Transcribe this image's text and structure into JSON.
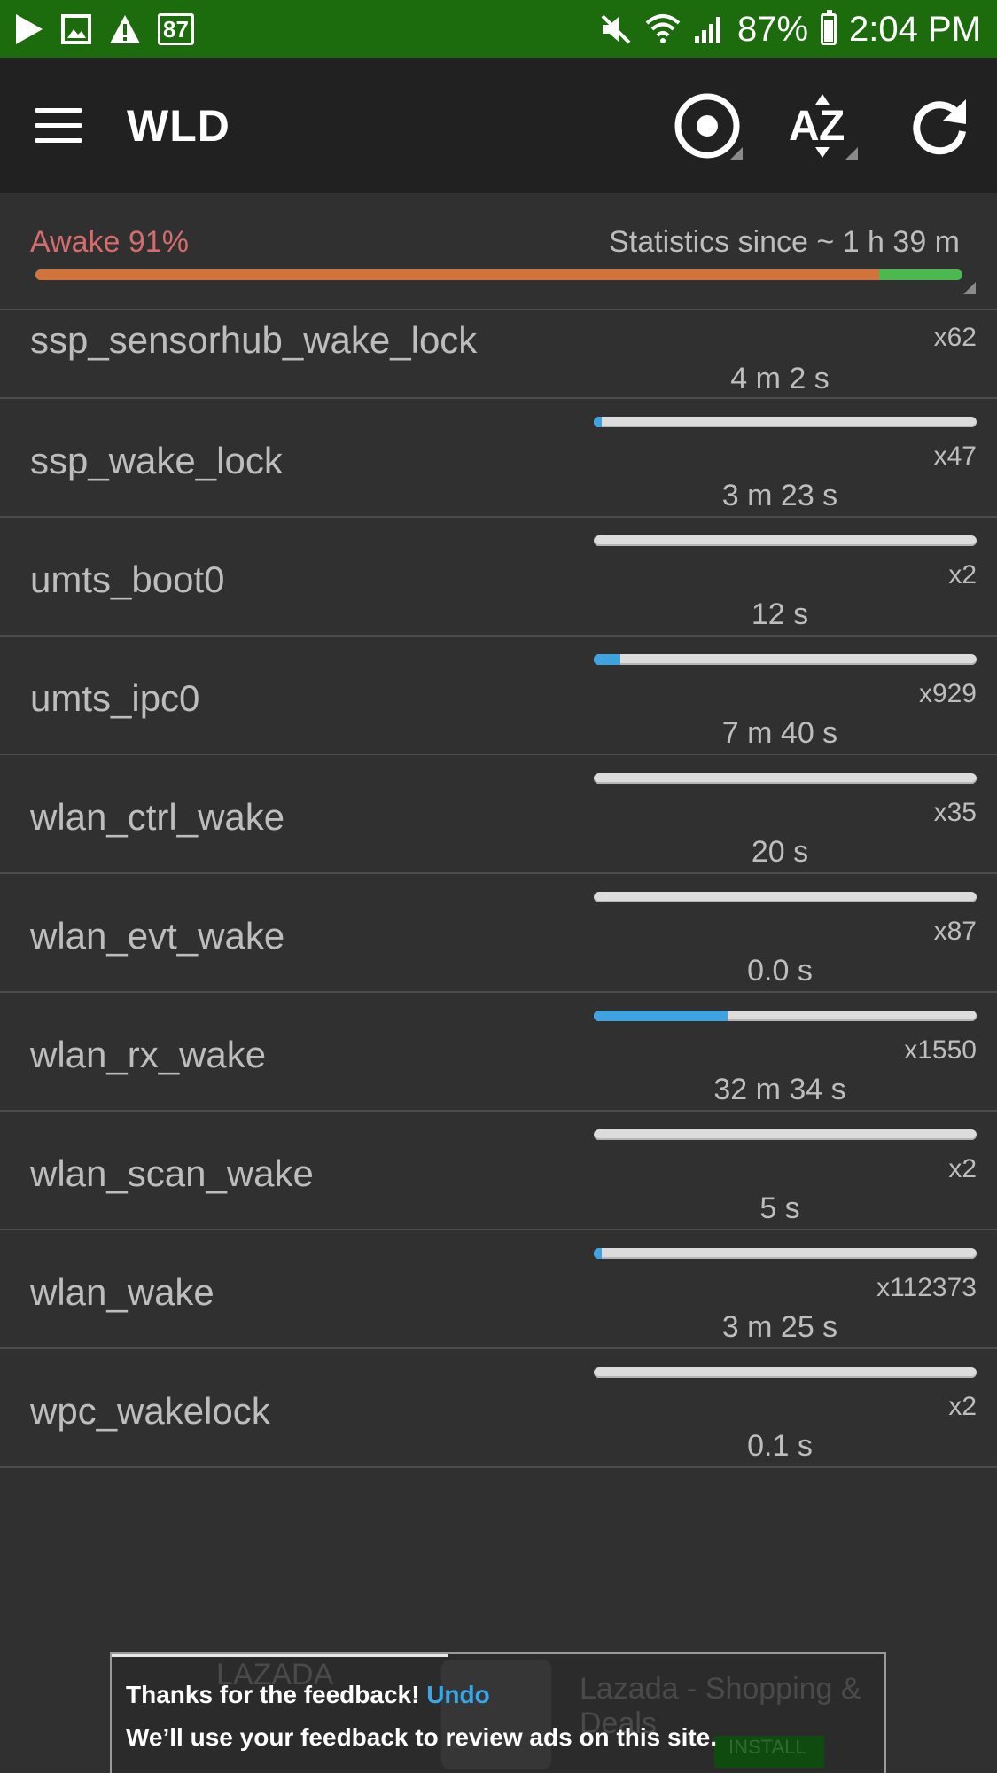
{
  "status_bar": {
    "notification_badge": "87",
    "battery_percent": "87%",
    "time": "2:04 PM",
    "icons": [
      "play-icon",
      "image-icon",
      "warning-icon",
      "mute-icon",
      "wifi-icon",
      "signal-icon",
      "battery-icon"
    ]
  },
  "toolbar": {
    "title": "WLD",
    "actions": [
      "record-icon",
      "sort-az-icon",
      "refresh-icon"
    ]
  },
  "summary": {
    "awake_label": "Awake 91%",
    "awake_fraction": 0.91,
    "stats_since": "Statistics since ~ 1 h 39 m"
  },
  "colors": {
    "status_bar": "#1c6b0d",
    "awake_text": "#d36c6c",
    "awake_bar": "#d1733b",
    "asleep_bar": "#4cb850",
    "row_bar_fill": "#3ea3df",
    "undo": "#38a7e8"
  },
  "wakelocks": [
    {
      "name": "ssp_sensorhub_wake_lock",
      "count": "x62",
      "duration": "4 m 2 s"
    },
    {
      "name": "ssp_wake_lock",
      "count": "x47",
      "duration": "3 m 23 s",
      "fraction": 0.02
    },
    {
      "name": "umts_boot0",
      "count": "x2",
      "duration": "12 s",
      "fraction": 0.0
    },
    {
      "name": "umts_ipc0",
      "count": "x929",
      "duration": "7 m 40 s",
      "fraction": 0.07
    },
    {
      "name": "wlan_ctrl_wake",
      "count": "x35",
      "duration": "20 s",
      "fraction": 0.0
    },
    {
      "name": "wlan_evt_wake",
      "count": "x87",
      "duration": "0.0 s",
      "fraction": 0.0
    },
    {
      "name": "wlan_rx_wake",
      "count": "x1550",
      "duration": "32 m 34 s",
      "fraction": 0.35
    },
    {
      "name": "wlan_scan_wake",
      "count": "x2",
      "duration": "5 s",
      "fraction": 0.0
    },
    {
      "name": "wlan_wake",
      "count": "x112373",
      "duration": "3 m 25 s",
      "fraction": 0.02
    },
    {
      "name": "wpc_wakelock",
      "count": "x2",
      "duration": "0.1 s",
      "fraction": 0.0
    }
  ],
  "snackbar": {
    "title": "Thanks for the feedback!",
    "undo_label": "Undo",
    "message": "We’ll use your feedback to review ads on this site."
  },
  "ad": {
    "brand": "LAZADA",
    "headline": "Lazada - Shopping & Deals",
    "install_label": "INSTALL"
  }
}
